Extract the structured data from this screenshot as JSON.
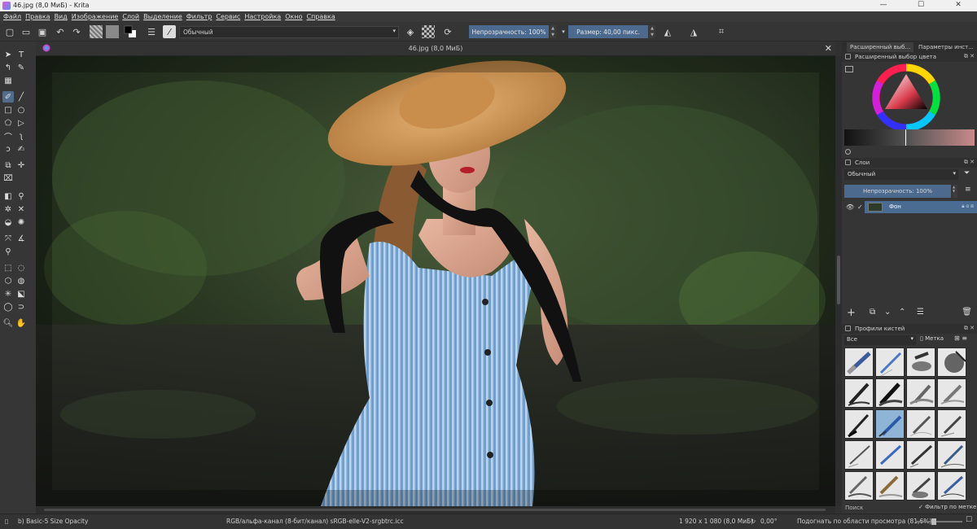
{
  "window": {
    "title": "46.jpg (8,0 МиБ)  - Krita",
    "min": "—",
    "max": "☐",
    "close": "✕"
  },
  "menu": [
    "Файл",
    "Правка",
    "Вид",
    "Изображение",
    "Слой",
    "Выделение",
    "Фильтр",
    "Сервис",
    "Настройка",
    "Окно",
    "Справка"
  ],
  "toolbar": {
    "blend_mode": "Обычный",
    "opacity": "Непрозрачность: 100%",
    "size": "Размер: 40,00 пикс."
  },
  "document_tab": {
    "name": "46.jpg (8,0 МиБ)",
    "close": "✕"
  },
  "dockers": {
    "tabs": [
      "Расширенный выб...",
      "Параметры инст..."
    ],
    "color_selector_title": "Расширенный выбор цвета",
    "layers_title": "Слои",
    "layers_blend": "Обычный",
    "layers_opacity": "Непрозрачность: 100%",
    "layer_name": "Фон",
    "brush_presets_title": "Профили кистей",
    "brush_filter": "Все",
    "brush_tag_label": "Метка",
    "search_placeholder": "Поиск",
    "filter_by_tag": "Фильтр по метке"
  },
  "statusbar": {
    "brush": "b) Basic-5 Size Opacity",
    "color_info": "RGB/альфа-канал (8-бит/канал)  sRGB-elle-V2-srgbtrc.icc",
    "dimensions": "1 920 x 1 080 (8,0 МиБ)",
    "rotation": "0,00°",
    "zoom": "Подогнать по области просмотра (81,6%)"
  },
  "colors": {
    "accent": "#4b6a8e",
    "layer_selected": "#4a6c93",
    "panel": "#353535"
  }
}
